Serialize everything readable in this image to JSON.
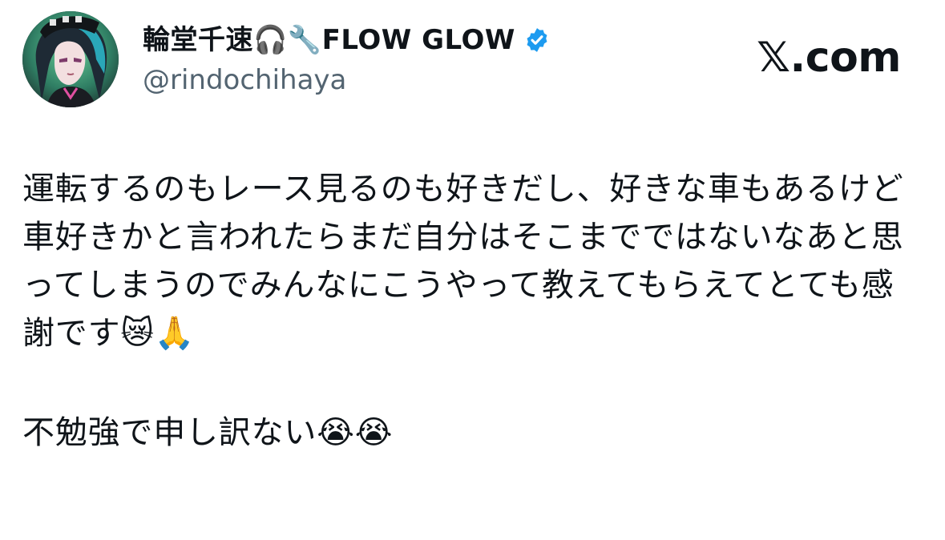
{
  "author": {
    "display_name": "輪堂千速🎧🔧FLOW GLOW",
    "handle": "@rindochihaya",
    "verified_color": "#1d9bf0",
    "avatar_icon": "user-avatar"
  },
  "site": {
    "brand": "𝕏.com"
  },
  "tweet": {
    "paragraph_1": "運転するのもレース見るのも好きだし、好きな車もあるけど車好きかと言われたらまだ自分はそこまでではないなあと思ってしまうのでみんなにこうやって教えてもらえてとても感謝です😿🙏",
    "paragraph_2": "不勉強で申し訳ない😭😭"
  }
}
